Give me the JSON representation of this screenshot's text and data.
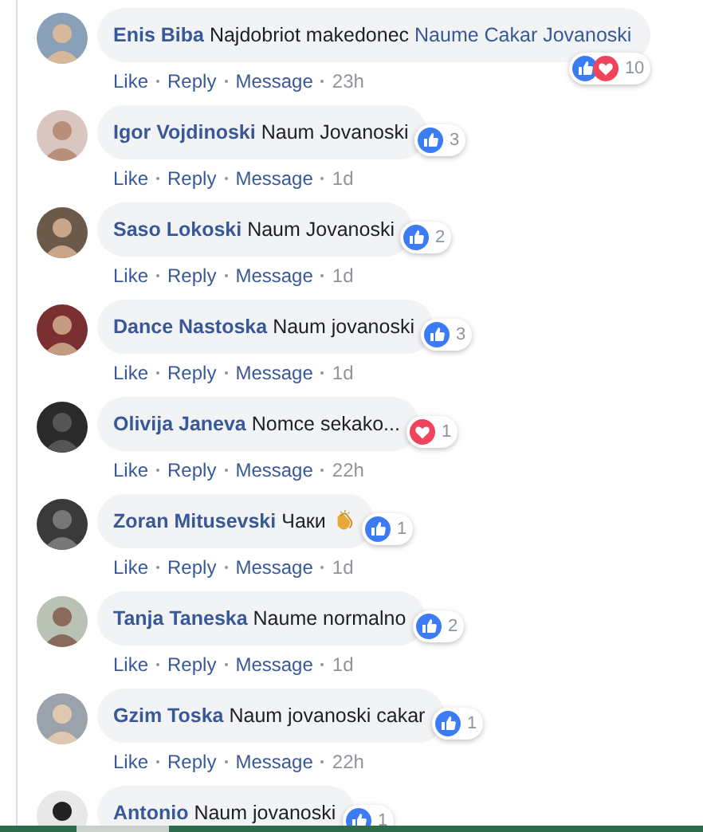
{
  "comments": [
    {
      "author": "Enis Biba",
      "text": "Najdobriot makedonec",
      "mention": "Naume Cakar Jovanoski",
      "has_emoji": false,
      "reactions": [
        {
          "kind": "like"
        },
        {
          "kind": "love"
        }
      ],
      "reaction_count": "10",
      "actions": [
        "Like",
        "Reply",
        "Message"
      ],
      "time": "23h"
    },
    {
      "author": "Igor Vojdinoski",
      "text": "Naum Jovanoski",
      "has_emoji": false,
      "reactions": [
        {
          "kind": "like"
        }
      ],
      "reaction_count": "3",
      "actions": [
        "Like",
        "Reply",
        "Message"
      ],
      "time": "1d"
    },
    {
      "author": "Saso Lokoski",
      "text": "Naum Jovanoski",
      "has_emoji": false,
      "reactions": [
        {
          "kind": "like"
        }
      ],
      "reaction_count": "2",
      "actions": [
        "Like",
        "Reply",
        "Message"
      ],
      "time": "1d"
    },
    {
      "author": "Dance Nastoska",
      "text": "Naum jovanoski",
      "has_emoji": false,
      "reactions": [
        {
          "kind": "like"
        }
      ],
      "reaction_count": "3",
      "actions": [
        "Like",
        "Reply",
        "Message"
      ],
      "time": "1d"
    },
    {
      "author": "Olivija Janeva",
      "text": "Nomce sekako...",
      "has_emoji": false,
      "reactions": [
        {
          "kind": "love"
        }
      ],
      "reaction_count": "1",
      "actions": [
        "Like",
        "Reply",
        "Message"
      ],
      "time": "22h"
    },
    {
      "author": "Zoran Mitusevski",
      "text": "Чаки",
      "has_emoji": true,
      "reactions": [
        {
          "kind": "like"
        }
      ],
      "reaction_count": "1",
      "actions": [
        "Like",
        "Reply",
        "Message"
      ],
      "time": "1d"
    },
    {
      "author": "Tanja Taneska",
      "text": "Naume normalno",
      "has_emoji": false,
      "reactions": [
        {
          "kind": "like"
        }
      ],
      "reaction_count": "2",
      "actions": [
        "Like",
        "Reply",
        "Message"
      ],
      "time": "1d"
    },
    {
      "author": "Gzim Toska",
      "text": "Naum jovanoski cakar",
      "has_emoji": false,
      "reactions": [
        {
          "kind": "like"
        }
      ],
      "reaction_count": "1",
      "actions": [
        "Like",
        "Reply",
        "Message"
      ],
      "time": "22h"
    },
    {
      "author": "Antonio",
      "text": "Naum jovanoski",
      "has_emoji": false,
      "reactions": [
        {
          "kind": "like"
        }
      ],
      "reaction_count": "1"
    }
  ]
}
